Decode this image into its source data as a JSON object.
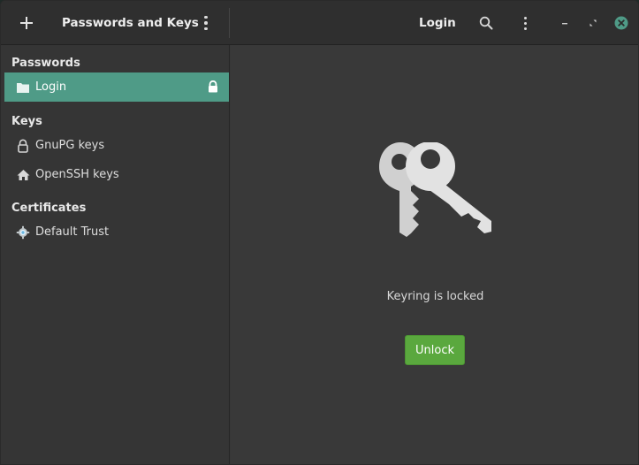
{
  "header": {
    "left_title": "Passwords and Keys",
    "right_title": "Login"
  },
  "sidebar": {
    "sections": [
      {
        "title": "Passwords",
        "items": [
          {
            "label": "Login",
            "icon": "folder-icon",
            "selected": true,
            "locked": true
          }
        ]
      },
      {
        "title": "Keys",
        "items": [
          {
            "label": "GnuPG keys",
            "icon": "gnupg-lock-icon"
          },
          {
            "label": "OpenSSH keys",
            "icon": "home-icon"
          }
        ]
      },
      {
        "title": "Certificates",
        "items": [
          {
            "label": "Default Trust",
            "icon": "trust-gear-icon"
          }
        ]
      }
    ]
  },
  "main": {
    "status_text": "Keyring is locked",
    "unlock_label": "Unlock"
  },
  "colors": {
    "accent": "#4f9b87",
    "unlock_button": "#5aa83e",
    "close_button": "#4f9b87"
  }
}
